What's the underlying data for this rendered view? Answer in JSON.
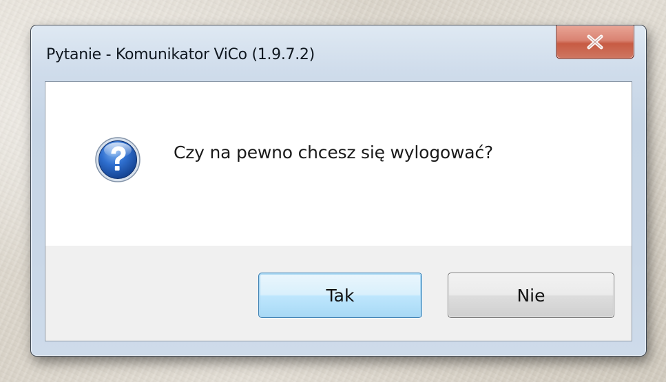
{
  "dialog": {
    "title": "Pytanie - Komunikator ViCo (1.9.7.2)",
    "close_icon": "close-icon",
    "message_icon": "question-icon",
    "message": "Czy na pewno chcesz się wylogować?",
    "buttons": {
      "yes_label": "Tak",
      "no_label": "Nie"
    }
  },
  "colors": {
    "close_button": "#c75b43",
    "question_icon": "#1d58b8",
    "default_button_border": "#3c7fb1"
  }
}
